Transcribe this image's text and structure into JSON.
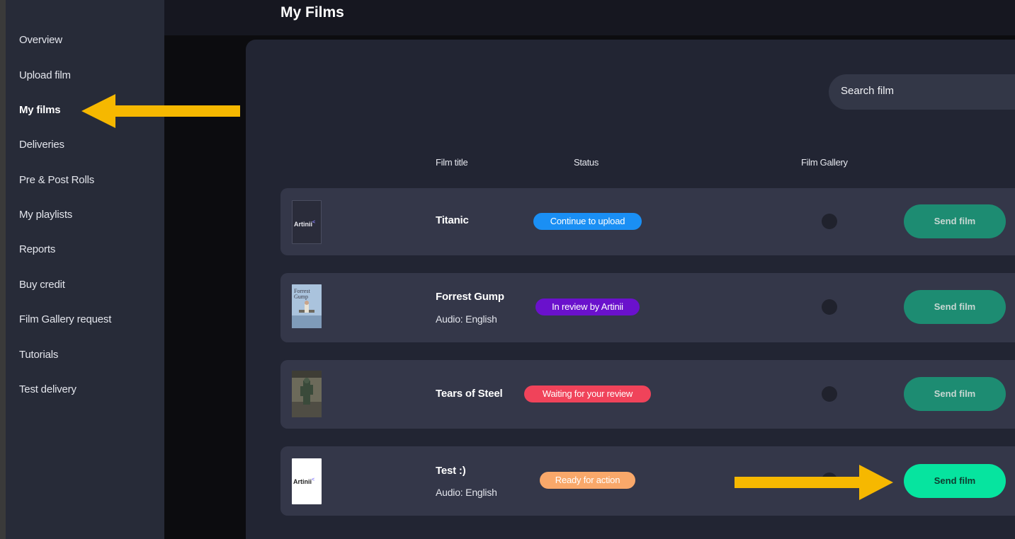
{
  "colors": {
    "sidebar_bg": "#272b38",
    "panel_bg": "#222533",
    "row_bg": "#343749",
    "continue_badge": "#1a8ff4",
    "review_badge": "#6a11cc",
    "waiting_badge": "#f0435a",
    "ready_badge": "#f9a86a",
    "send_dim": "#1d8c72",
    "send_bright": "#06e49f",
    "annotation_arrow": "#f6b800"
  },
  "sidebar": {
    "items": [
      {
        "label": "Overview"
      },
      {
        "label": "Upload film"
      },
      {
        "label": "My films",
        "active": true
      },
      {
        "label": "Deliveries"
      },
      {
        "label": "Pre & Post Rolls"
      },
      {
        "label": "My playlists"
      },
      {
        "label": "Reports"
      },
      {
        "label": "Buy credit"
      },
      {
        "label": "Film Gallery request"
      },
      {
        "label": "Tutorials"
      },
      {
        "label": "Test delivery"
      }
    ]
  },
  "header": {
    "title": "My Films"
  },
  "search": {
    "placeholder": "Search film"
  },
  "table": {
    "columns": [
      "Film title",
      "Status",
      "Film Gallery"
    ],
    "rows": [
      {
        "title": "Titanic",
        "audio": "",
        "status": "Continue to upload",
        "thumb": "Artinii",
        "button": "Send film"
      },
      {
        "title": "Forrest Gump",
        "audio": "Audio: English",
        "status": "In review by Artinii",
        "thumb": "Forrest Gump",
        "button": "Send film"
      },
      {
        "title": "Tears of Steel",
        "audio": "",
        "status": "Waiting for your review",
        "thumb": "",
        "button": "Send film"
      },
      {
        "title": "Test :)",
        "audio": "Audio: English",
        "status": "Ready for action",
        "thumb": "Artinii",
        "button": "Send film"
      }
    ]
  }
}
